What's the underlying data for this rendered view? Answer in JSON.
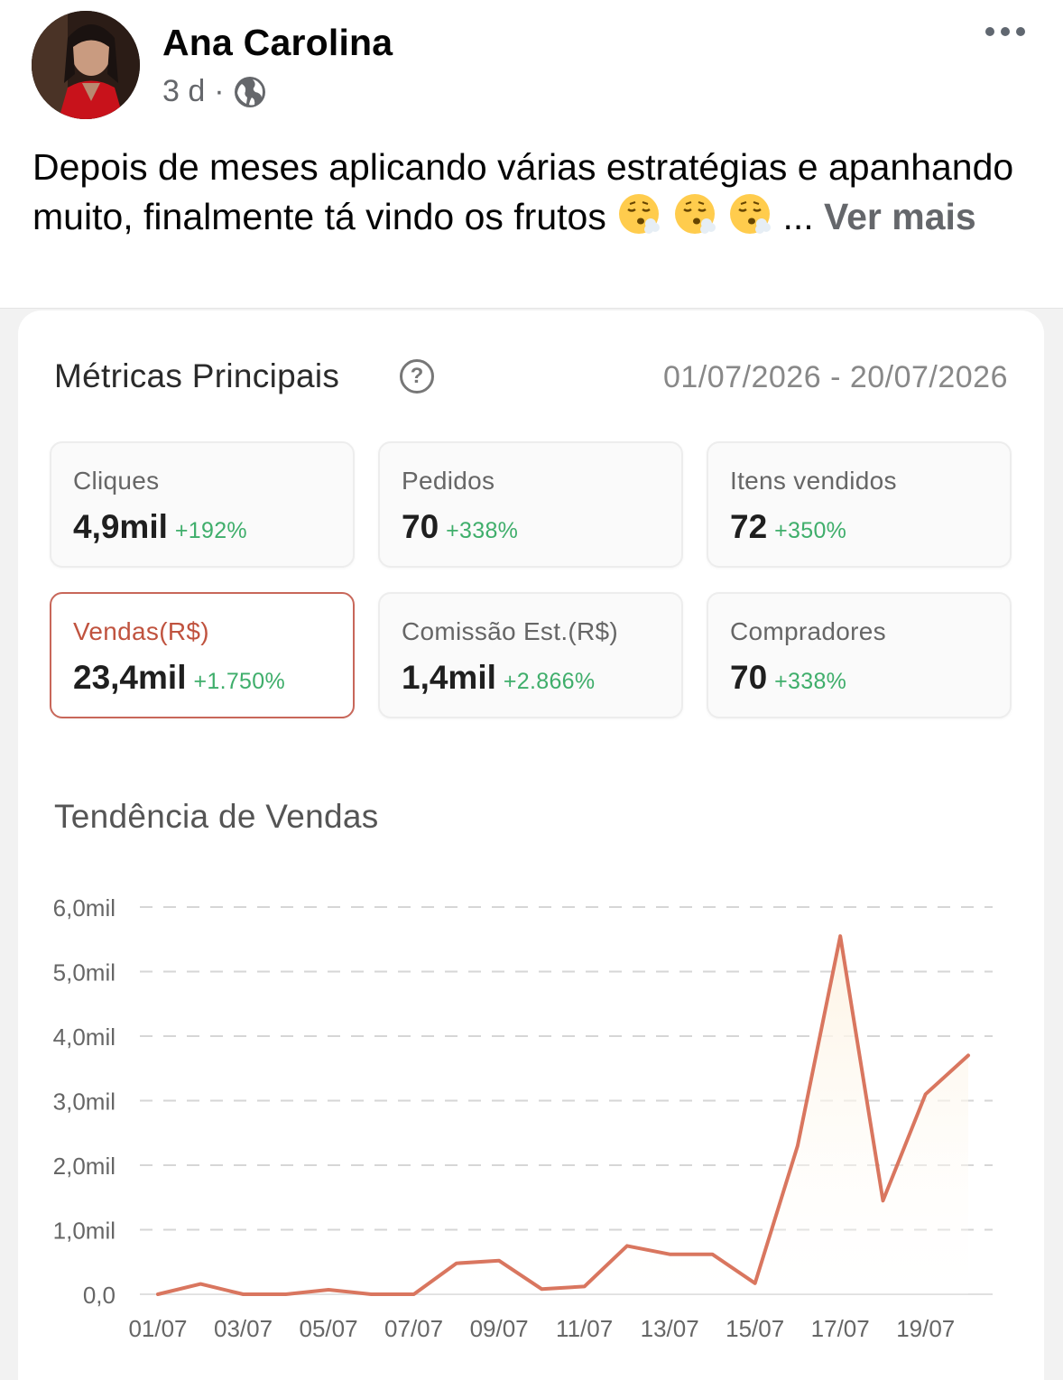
{
  "post": {
    "author": "Ana Carolina",
    "time": "3 d",
    "separator": "·",
    "privacy_icon": "globe-icon",
    "text": "Depois de meses aplicando várias estratégias e apanhando muito, finalmente tá vindo os frutos",
    "emoji_icon": "face-exhaling-emoji",
    "ellipsis": "...",
    "see_more": "Ver mais"
  },
  "metrics": {
    "title": "Métricas Principais",
    "help": "?",
    "date_range": "01/07/2026 - 20/07/2026",
    "cards": [
      {
        "label": "Cliques",
        "value": "4,9mil",
        "delta": "+192%"
      },
      {
        "label": "Pedidos",
        "value": "70",
        "delta": "+338%"
      },
      {
        "label": "Itens vendidos",
        "value": "72",
        "delta": "+350%"
      },
      {
        "label": "Vendas(R$)",
        "value": "23,4mil",
        "delta": "+1.750%",
        "active": true
      },
      {
        "label": "Comissão Est.(R$)",
        "value": "1,4mil",
        "delta": "+2.866%"
      },
      {
        "label": "Compradores",
        "value": "70",
        "delta": "+338%"
      }
    ]
  },
  "trend": {
    "title": "Tendência de Vendas"
  },
  "colors": {
    "line": "#d9765f",
    "fill": "#fdf3e3",
    "positive": "#3fae6b",
    "active_border": "#c8675a"
  },
  "chart_data": {
    "type": "area",
    "title": "Tendência de Vendas",
    "x": [
      "01/07",
      "02/07",
      "03/07",
      "04/07",
      "05/07",
      "06/07",
      "07/07",
      "08/07",
      "09/07",
      "10/07",
      "11/07",
      "12/07",
      "13/07",
      "14/07",
      "15/07",
      "16/07",
      "17/07",
      "18/07",
      "19/07",
      "20/07"
    ],
    "x_tick_labels": [
      "01/07",
      "03/07",
      "05/07",
      "07/07",
      "09/07",
      "11/07",
      "13/07",
      "15/07",
      "17/07",
      "19/07"
    ],
    "series": [
      {
        "values": [
          0,
          160,
          0,
          0,
          70,
          0,
          0,
          480,
          520,
          80,
          120,
          750,
          620,
          620,
          170,
          2300,
          5550,
          1450,
          3100,
          3700
        ]
      }
    ],
    "ylim": [
      0,
      6000
    ],
    "y_ticks": [
      0,
      1000,
      2000,
      3000,
      4000,
      5000,
      6000
    ],
    "y_tick_labels": [
      "0,0",
      "1,0mil",
      "2,0mil",
      "3,0mil",
      "4,0mil",
      "5,0mil",
      "6,0mil"
    ],
    "grid": true,
    "grid_style": "dashed-horizontal"
  }
}
